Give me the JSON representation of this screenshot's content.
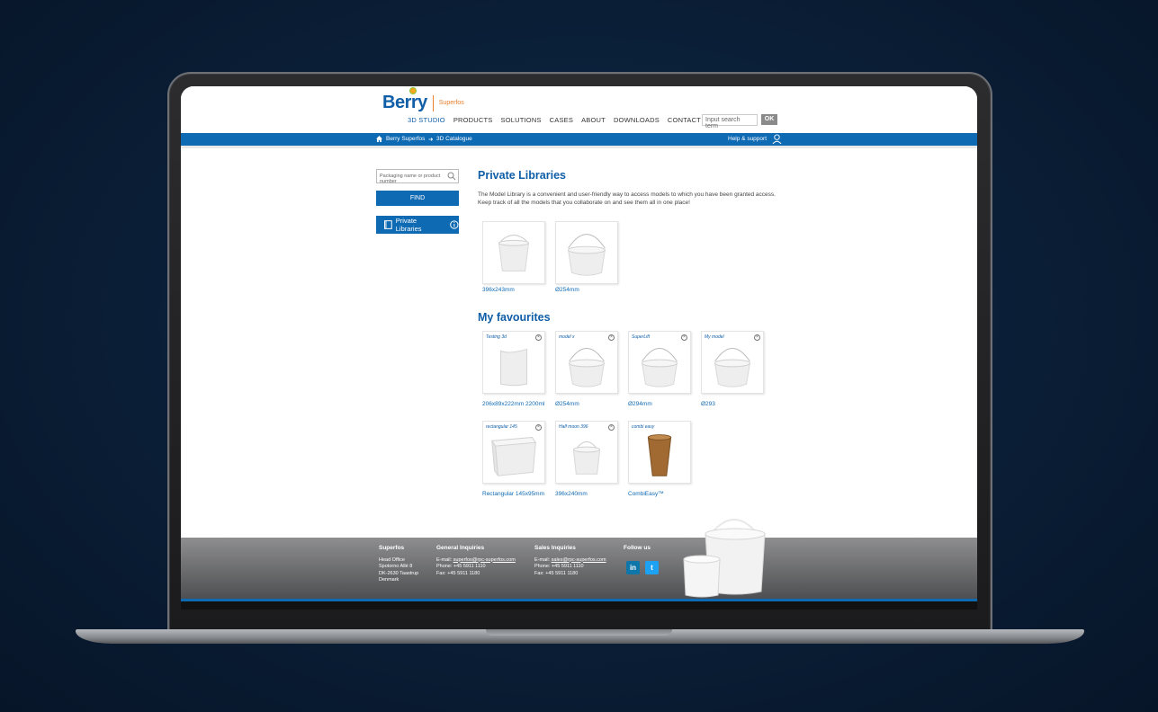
{
  "header": {
    "logo_main": "Berry",
    "logo_sub": "Superfos",
    "nav": [
      "3D STUDIO",
      "PRODUCTS",
      "SOLUTIONS",
      "CASES",
      "ABOUT",
      "DOWNLOADS",
      "CONTACT"
    ],
    "search_placeholder": "Input search term",
    "ok_label": "OK"
  },
  "breadcrumb": {
    "items": [
      "Berry Superfos",
      "3D Catalogue"
    ],
    "help": "Help & support"
  },
  "sidebar": {
    "search_placeholder": "Packaging name or product number",
    "find_label": "FIND",
    "private_label": "Private Libraries"
  },
  "private": {
    "title": "Private Libraries",
    "intro": "The Model Library is a convenient and user-friendly way to access models to which you have been granted access. Keep track of all the models that you collaborate on and see them all in one place!",
    "items": [
      {
        "caption": "396x243mm"
      },
      {
        "caption": "Ø254mm"
      }
    ]
  },
  "favourites": {
    "title": "My favourites",
    "items": [
      {
        "label": "Testing 3d",
        "caption": "206x89x222mm 2200ml"
      },
      {
        "label": "model x",
        "caption": "Ø254mm"
      },
      {
        "label": "SuperLift",
        "caption": "Ø294mm"
      },
      {
        "label": "My model",
        "caption": "Ø293"
      },
      {
        "label": "rectangular 145",
        "caption": "Rectangular 145x95mm"
      },
      {
        "label": "Half moon 396",
        "caption": "396x240mm"
      },
      {
        "label": "combi easy",
        "caption": "CombiEasy™"
      }
    ]
  },
  "footer": {
    "superfos": {
      "title": "Superfos",
      "lines": [
        "Head Office",
        "Spotorno Allé 8",
        "DK-2630 Taastrup",
        "Denmark"
      ]
    },
    "general": {
      "title": "General Inquiries",
      "email_prefix": "E-mail:",
      "email": "superfos@rpc-superfos.com",
      "phone": "Phone:  +45 5911 1110",
      "fax": "Fax:     +45 5911 1180"
    },
    "sales": {
      "title": "Sales Inquiries",
      "email_prefix": "E-mail:",
      "email": "sales@rpc-superfos.com",
      "phone": "Phone:  +45 5911 1110",
      "fax": "Fax:    +45 5911 1180"
    },
    "follow": {
      "title": "Follow us",
      "linkedin": "in",
      "twitter": "t"
    }
  },
  "colors": {
    "brand_blue": "#0f6ab4",
    "accent_orange": "#e8802e"
  }
}
